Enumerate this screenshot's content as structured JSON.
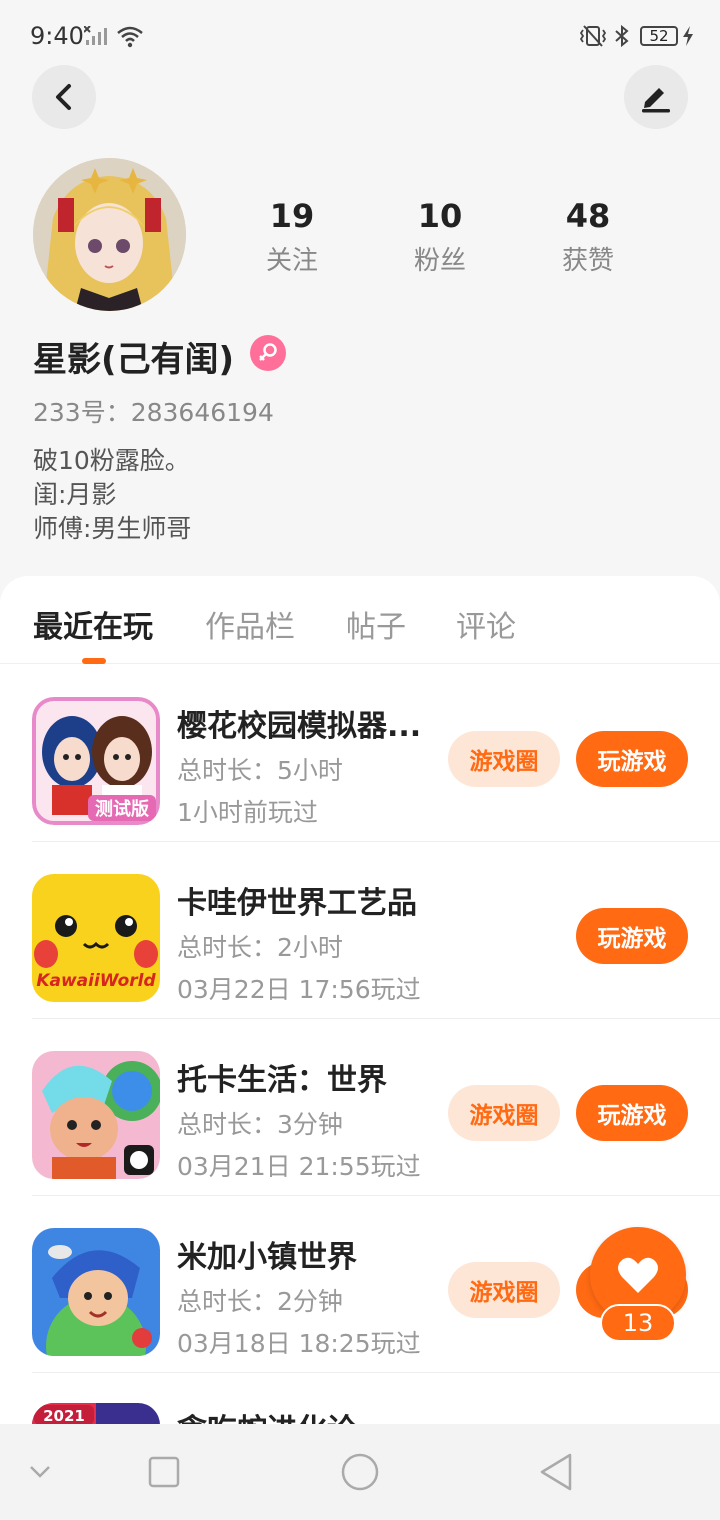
{
  "status_bar": {
    "time": "9:40",
    "battery": "52"
  },
  "profile": {
    "stats": [
      {
        "value": "19",
        "label": "关注"
      },
      {
        "value": "10",
        "label": "粉丝"
      },
      {
        "value": "48",
        "label": "获赞"
      }
    ],
    "nickname": "星影(己有闺)",
    "uid": "233号：283646194",
    "bio": [
      "破10粉露脸。",
      "闺:月影",
      "师傅:男生师哥"
    ]
  },
  "tabs": [
    {
      "label": "最近在玩",
      "active": true
    },
    {
      "label": "作品栏",
      "active": false
    },
    {
      "label": "帖子",
      "active": false
    },
    {
      "label": "评论",
      "active": false
    }
  ],
  "games": [
    {
      "name": "樱花校园模拟器...",
      "duration": "总时长：5小时",
      "last_played": "1小时前玩过",
      "circle_label": "游戏圈",
      "play_label": "玩游戏"
    },
    {
      "name": "卡哇伊世界工艺品",
      "duration": "总时长：2小时",
      "last_played": "03月22日 17:56玩过",
      "play_label": "玩游戏"
    },
    {
      "name": "托卡生活：世界",
      "duration": "总时长：3分钟",
      "last_played": "03月21日 21:55玩过",
      "circle_label": "游戏圈",
      "play_label": "玩游戏"
    },
    {
      "name": "米加小镇世界",
      "duration": "总时长：2分钟",
      "last_played": "03月18日 18:25玩过",
      "circle_label": "游戏圈",
      "play_label": "玩游戏"
    }
  ],
  "game_icon_texts": {
    "sakura_badge": "测试版",
    "kawaii_logo": "KawaiiWorld",
    "partial_badge": "2021"
  },
  "partial_game_name": "贪吃蛇进化论",
  "like": {
    "count": "13"
  },
  "colors": {
    "accent": "#ff6a13",
    "accent_light": "#fde6d6",
    "gender_badge": "#ff6f9a"
  }
}
